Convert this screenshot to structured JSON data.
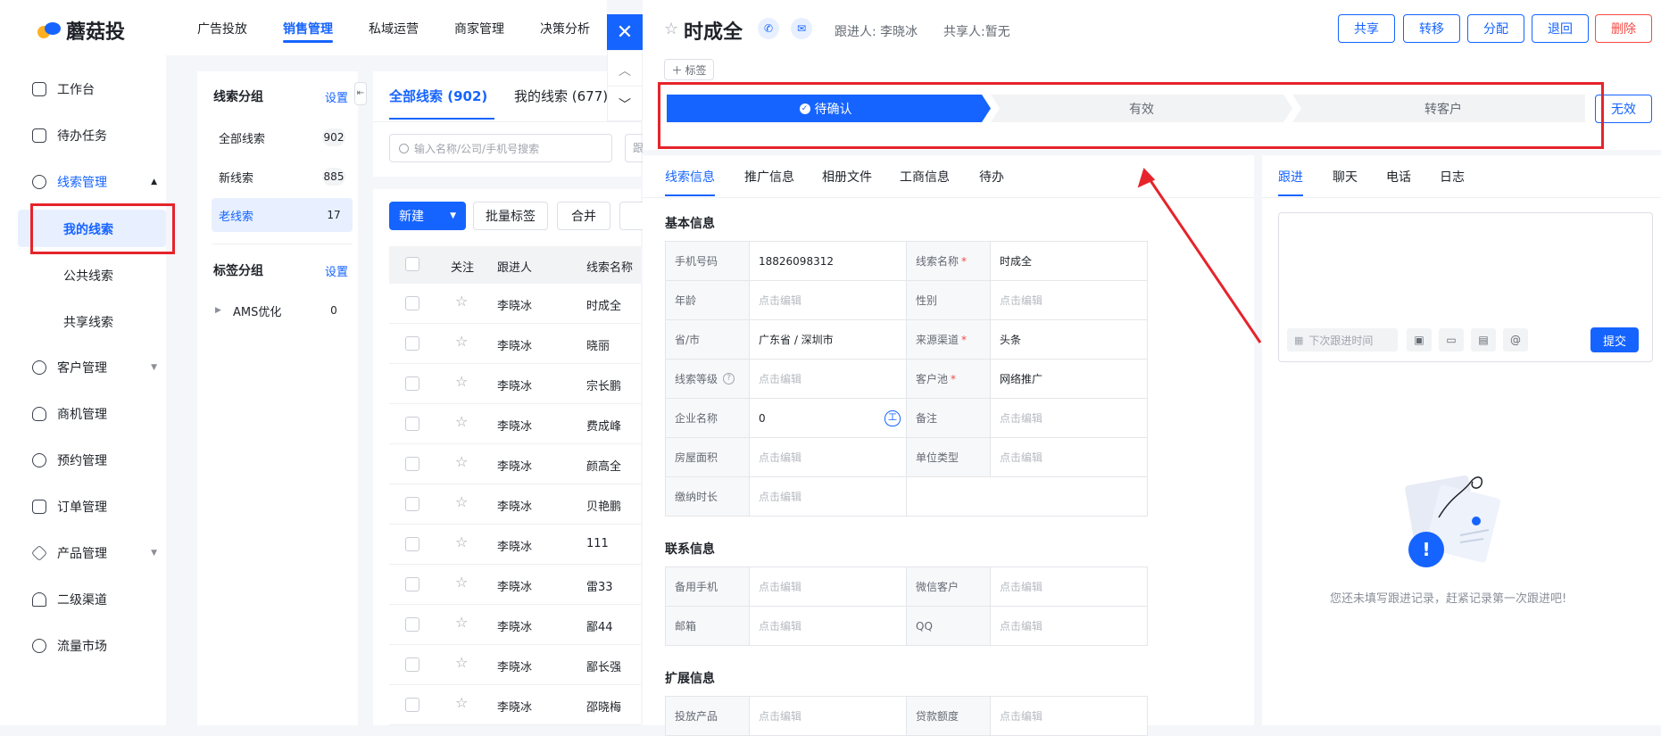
{
  "app": {
    "name": "蘑菇投"
  },
  "topnav": [
    "广告投放",
    "销售管理",
    "私域运营",
    "商家管理",
    "决策分析"
  ],
  "sidebar": {
    "items": [
      {
        "label": "工作台",
        "icon": "dashboard-icon"
      },
      {
        "label": "待办任务",
        "icon": "task-icon"
      },
      {
        "label": "线索管理",
        "icon": "leads-icon"
      },
      {
        "label": "客户管理",
        "icon": "customer-icon"
      },
      {
        "label": "商机管理",
        "icon": "bulb-icon"
      },
      {
        "label": "预约管理",
        "icon": "clock-icon"
      },
      {
        "label": "订单管理",
        "icon": "order-icon"
      },
      {
        "label": "产品管理",
        "icon": "layers-icon"
      },
      {
        "label": "二级渠道",
        "icon": "channel-icon"
      },
      {
        "label": "流量市场",
        "icon": "market-icon"
      }
    ],
    "subitems": [
      "我的线索",
      "公共线索",
      "共享线索"
    ]
  },
  "groups": {
    "title": "线索分组",
    "settings": "设置",
    "items": [
      {
        "label": "全部线索",
        "count": "902"
      },
      {
        "label": "新线索",
        "count": "885"
      },
      {
        "label": "老线索",
        "count": "17"
      }
    ],
    "tag_title": "标签分组",
    "tag_settings": "设置",
    "tags": [
      {
        "label": "AMS优化",
        "count": "0"
      }
    ]
  },
  "list": {
    "tabs": [
      "全部线索 (902)",
      "我的线索 (677)"
    ],
    "search_placeholder": "输入名称/公司/手机号搜索",
    "search_trunc": "跟",
    "buttons": {
      "new": "新建",
      "batch_tag": "批量标签",
      "merge": "合并"
    },
    "headers": [
      "关注",
      "跟进人",
      "线索名称"
    ],
    "rows": [
      {
        "owner": "李晓冰",
        "name": "时成全"
      },
      {
        "owner": "李晓冰",
        "name": "晓丽"
      },
      {
        "owner": "李晓冰",
        "name": "宗长鹏"
      },
      {
        "owner": "李晓冰",
        "name": "费成峰"
      },
      {
        "owner": "李晓冰",
        "name": "颜高全"
      },
      {
        "owner": "李晓冰",
        "name": "贝艳鹏"
      },
      {
        "owner": "李晓冰",
        "name": "111"
      },
      {
        "owner": "李晓冰",
        "name": "雷33"
      },
      {
        "owner": "李晓冰",
        "name": "鄙44"
      },
      {
        "owner": "李晓冰",
        "name": "鄙长强"
      },
      {
        "owner": "李晓冰",
        "name": "邵晓梅"
      }
    ]
  },
  "detail": {
    "name": "时成全",
    "owner": "跟进人: 李晓冰",
    "shared": "共享人:暂无",
    "actions": [
      "共享",
      "转移",
      "分配",
      "退回",
      "删除"
    ],
    "tag_button": "标签",
    "steps": [
      "待确认",
      "有效",
      "转客户"
    ],
    "invalid": "无效",
    "tabs": [
      "线索信息",
      "推广信息",
      "相册文件",
      "工商信息",
      "待办"
    ],
    "sections": {
      "basic": "基本信息",
      "contact": "联系信息",
      "extended": "扩展信息"
    },
    "basic_rows": [
      {
        "l1": "手机号码",
        "v1": "18826098312",
        "l2": "线索名称",
        "r2": true,
        "v2": "时成全"
      },
      {
        "l1": "年龄",
        "v1": "点击编辑",
        "l2": "性别",
        "r2": false,
        "v2": "点击编辑"
      },
      {
        "l1": "省/市",
        "v1": "广东省 / 深圳市",
        "l2": "来源渠道",
        "r2": true,
        "v2": "头条"
      },
      {
        "l1": "线索等级",
        "v1": "点击编辑",
        "l2": "客户池",
        "r2": true,
        "v2": "网络推广"
      },
      {
        "l1": "企业名称",
        "v1": "0",
        "l2": "备注",
        "r2": false,
        "v2": "点击编辑"
      },
      {
        "l1": "房屋面积",
        "v1": "点击编辑",
        "l2": "单位类型",
        "r2": false,
        "v2": "点击编辑"
      },
      {
        "l1": "缴纳时长",
        "v1": "点击编辑",
        "l2": "",
        "r2": false,
        "v2": ""
      }
    ],
    "contact_rows": [
      {
        "l1": "备用手机",
        "v1": "点击编辑",
        "l2": "微信客户",
        "v2": "点击编辑"
      },
      {
        "l1": "邮箱",
        "v1": "点击编辑",
        "l2": "QQ",
        "v2": "点击编辑"
      }
    ],
    "extended_rows": [
      {
        "l1": "投放产品",
        "v1": "点击编辑",
        "l2": "贷款额度",
        "v2": "点击编辑"
      }
    ],
    "right_tabs": [
      "跟进",
      "聊天",
      "电话",
      "日志"
    ],
    "next_followup_placeholder": "下次跟进时间",
    "submit": "提交",
    "empty_text": "您还未填写跟进记录，赶紧记录第一次跟进吧!"
  },
  "colors": {
    "primary": "#1664ff",
    "danger": "#f54a45",
    "annotation": "#e5242b"
  }
}
